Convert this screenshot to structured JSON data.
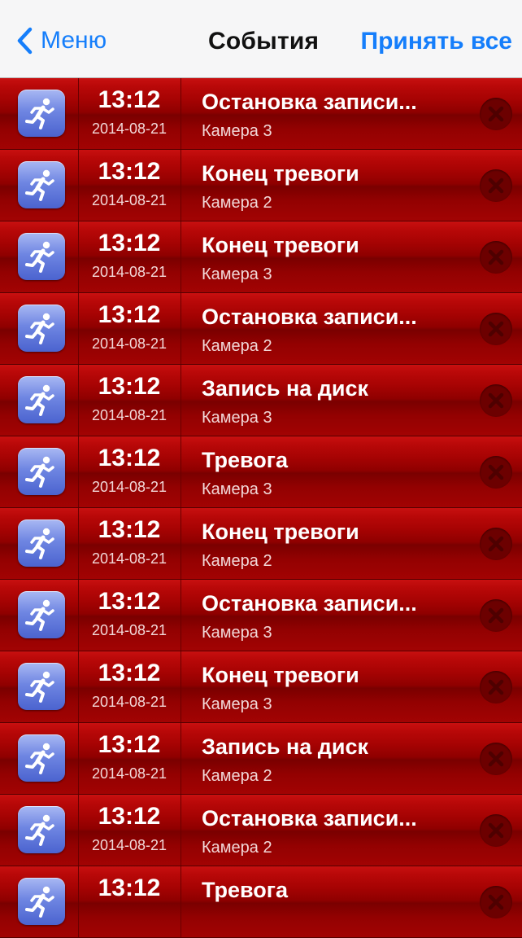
{
  "navbar": {
    "back_label": "Меню",
    "title": "События",
    "accept_all_label": "Принять все"
  },
  "events": [
    {
      "time": "13:12",
      "date": "2014-08-21",
      "title": "Остановка записи...",
      "camera": "Камера 3"
    },
    {
      "time": "13:12",
      "date": "2014-08-21",
      "title": "Конец тревоги",
      "camera": "Камера 2"
    },
    {
      "time": "13:12",
      "date": "2014-08-21",
      "title": "Конец тревоги",
      "camera": "Камера 3"
    },
    {
      "time": "13:12",
      "date": "2014-08-21",
      "title": "Остановка записи...",
      "camera": "Камера 2"
    },
    {
      "time": "13:12",
      "date": "2014-08-21",
      "title": "Запись на диск",
      "camera": "Камера 3"
    },
    {
      "time": "13:12",
      "date": "2014-08-21",
      "title": "Тревога",
      "camera": "Камера 3"
    },
    {
      "time": "13:12",
      "date": "2014-08-21",
      "title": "Конец тревоги",
      "camera": "Камера 2"
    },
    {
      "time": "13:12",
      "date": "2014-08-21",
      "title": "Остановка записи...",
      "camera": "Камера 3"
    },
    {
      "time": "13:12",
      "date": "2014-08-21",
      "title": "Конец тревоги",
      "camera": "Камера 3"
    },
    {
      "time": "13:12",
      "date": "2014-08-21",
      "title": "Запись на диск",
      "camera": "Камера 2"
    },
    {
      "time": "13:12",
      "date": "2014-08-21",
      "title": "Остановка записи...",
      "camera": "Камера 2"
    },
    {
      "time": "13:12",
      "date": "",
      "title": "Тревога",
      "camera": ""
    }
  ],
  "icons": {
    "back": "chevron-left-icon",
    "event": "running-man-icon",
    "delete": "delete-circle-icon"
  },
  "colors": {
    "accent": "#157efb",
    "row_red": "#a60303",
    "icon_blue": "#6f86e2"
  }
}
